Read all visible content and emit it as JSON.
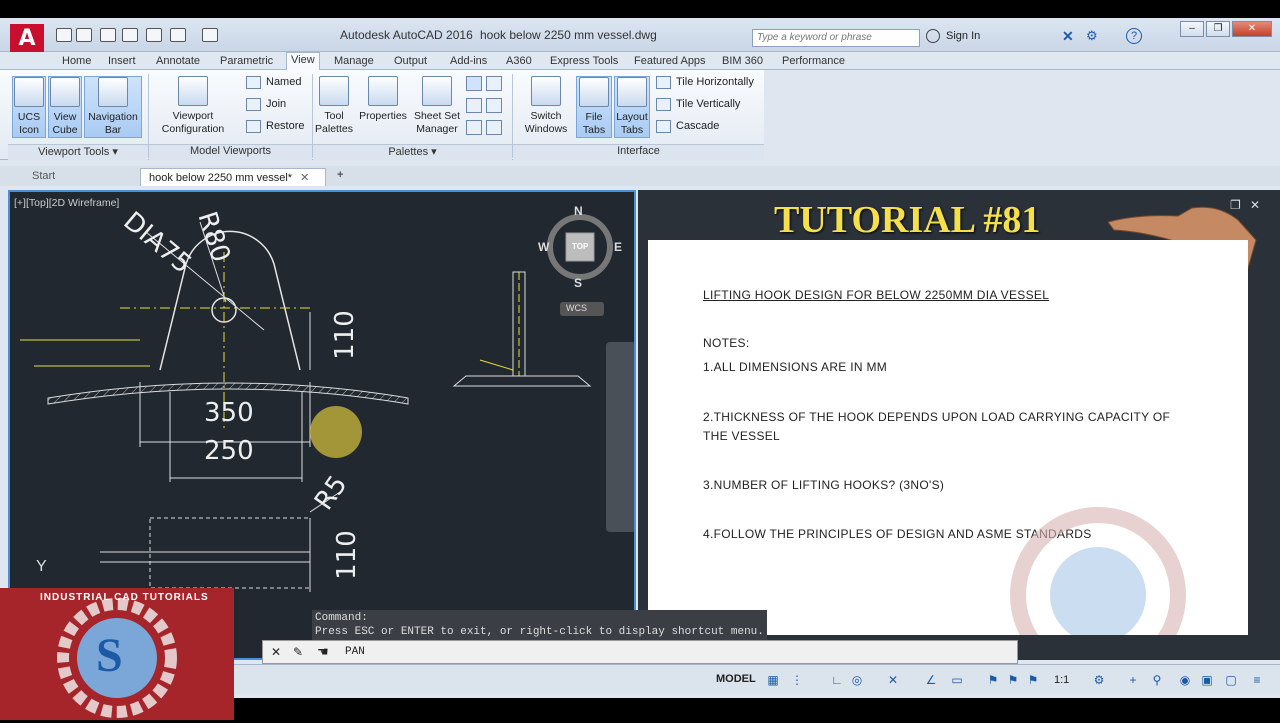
{
  "window": {
    "app_title": "Autodesk AutoCAD 2016",
    "file_title": "hook below 2250 mm vessel.dwg",
    "search_placeholder": "Type a keyword or phrase",
    "sign_in": "Sign In"
  },
  "ribbon_tabs": [
    "Home",
    "Insert",
    "Annotate",
    "Parametric",
    "View",
    "Manage",
    "Output",
    "Add-ins",
    "A360",
    "Express Tools",
    "Featured Apps",
    "BIM 360",
    "Performance"
  ],
  "ribbon": {
    "ucs_icon": "UCS\nIcon",
    "view_cube": "View\nCube",
    "navigation_bar": "Navigation\nBar",
    "viewport_configuration": "Viewport\nConfiguration",
    "named": "Named",
    "join": "Join",
    "restore": "Restore",
    "tool_palettes": "Tool\nPalettes",
    "properties": "Properties",
    "sheet_set_manager": "Sheet Set\nManager",
    "switch_windows": "Switch\nWindows",
    "file_tabs": "File\nTabs",
    "layout_tabs": "Layout\nTabs",
    "tile_horizontally": "Tile Horizontally",
    "tile_vertically": "Tile Vertically",
    "cascade": "Cascade",
    "panel_viewport_tools": "Viewport Tools",
    "panel_model_viewports": "Model Viewports",
    "panel_palettes": "Palettes",
    "panel_interface": "Interface"
  },
  "file_tabs": {
    "start": "Start",
    "active": "hook below 2250 mm vessel*"
  },
  "viewport": {
    "label": "[+][Top][2D Wireframe]",
    "compass": {
      "n": "N",
      "s": "S",
      "e": "E",
      "w": "W",
      "top": "TOP",
      "wcs": "WCS"
    },
    "dims": {
      "r80": "R80",
      "dia75": "DIA75",
      "d110a": "110",
      "d350": "350",
      "d250": "250",
      "r5": "R5",
      "d110b": "110",
      "y_axis": "Y"
    }
  },
  "overlay": {
    "tutorial": "TUTORIAL #81"
  },
  "notes": {
    "heading": "LIFTING HOOK DESIGN FOR BELOW 2250MM DIA VESSEL",
    "notes_label": "NOTES:",
    "n1": "1.ALL DIMENSIONS ARE IN MM",
    "n2a": "2.THICKNESS OF THE HOOK DEPENDS UPON LOAD CARRYING CAPACITY OF",
    "n2b": "THE VESSEL",
    "n3": "3.NUMBER OF LIFTING HOOKS?   (3NO'S)",
    "n4": "4.FOLLOW THE PRINCIPLES OF DESIGN AND ASME STANDARDS"
  },
  "command": {
    "line1": "Command:",
    "line2": "Press ESC or ENTER to exit, or right-click to display shortcut menu.",
    "input": "PAN"
  },
  "status": {
    "model": "MODEL",
    "scale": "1:1"
  },
  "logo": {
    "text": "INDUSTRIAL CAD TUTORIALS",
    "letter": "S"
  },
  "colors": {
    "accent": "#4a90d9",
    "tutorial_yellow": "#f5e04b",
    "drawing_yellow": "#e8e03c",
    "logo_red": "#a6252a"
  }
}
